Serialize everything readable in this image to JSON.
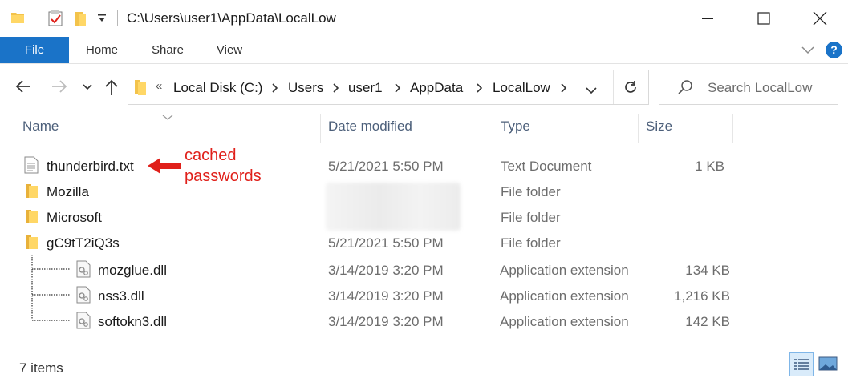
{
  "window": {
    "title": "C:\\Users\\user1\\AppData\\LocalLow",
    "colors": {
      "accent": "#1a73c8",
      "annotation": "#e0201a"
    }
  },
  "ribbon": {
    "tabs": [
      "File",
      "Home",
      "Share",
      "View"
    ],
    "help_label": "?"
  },
  "address": {
    "overflow": "«",
    "segments": [
      "Local Disk (C:)",
      "Users",
      "user1",
      "AppData",
      "LocalLow"
    ]
  },
  "search": {
    "placeholder": "Search LocalLow"
  },
  "columns": {
    "name": "Name",
    "date": "Date modified",
    "type": "Type",
    "size": "Size"
  },
  "files": [
    {
      "name": "thunderbird.txt",
      "icon": "text-file-icon",
      "date": "5/21/2021 5:50 PM",
      "type": "Text Document",
      "size": "1 KB"
    },
    {
      "name": "Mozilla",
      "icon": "folder-icon",
      "date": "",
      "type": "File folder",
      "size": ""
    },
    {
      "name": "Microsoft",
      "icon": "folder-icon",
      "date": "",
      "type": "File folder",
      "size": ""
    },
    {
      "name": "gC9tT2iQ3s",
      "icon": "folder-icon",
      "date": "5/21/2021 5:50 PM",
      "type": "File folder",
      "size": ""
    },
    {
      "name": "mozglue.dll",
      "icon": "dll-file-icon",
      "date": "3/14/2019 3:20 PM",
      "type": "Application extension",
      "size": "134 KB"
    },
    {
      "name": "nss3.dll",
      "icon": "dll-file-icon",
      "date": "3/14/2019 3:20 PM",
      "type": "Application extension",
      "size": "1,216 KB"
    },
    {
      "name": "softokn3.dll",
      "icon": "dll-file-icon",
      "date": "3/14/2019 3:20 PM",
      "type": "Application extension",
      "size": "142 KB"
    }
  ],
  "annotation": {
    "line1": "cached",
    "line2": "passwords"
  },
  "status": {
    "item_count": "7 items"
  }
}
